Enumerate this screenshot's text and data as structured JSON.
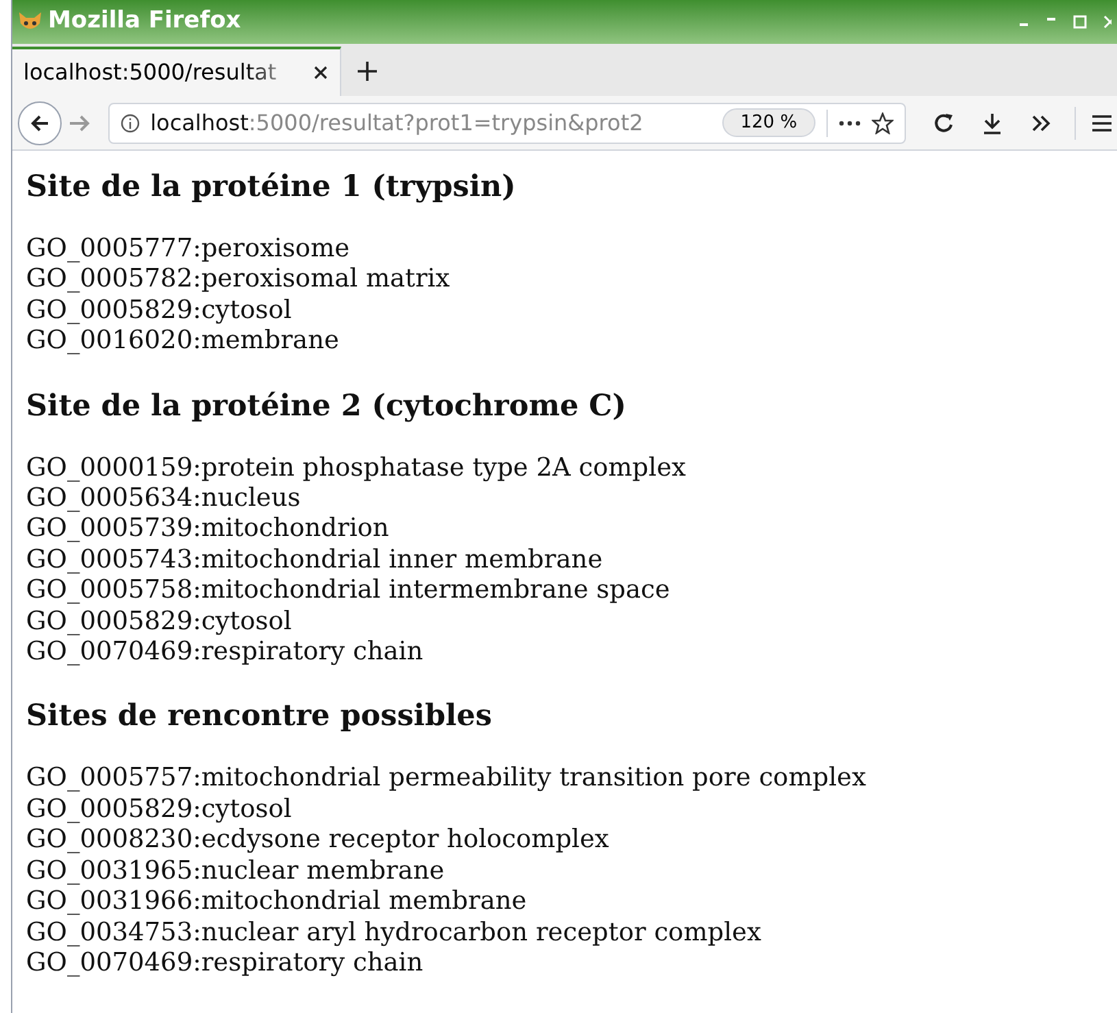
{
  "window": {
    "title": "Mozilla Firefox"
  },
  "tabs": [
    {
      "label": "localhost:5000/resultat",
      "selected": true
    }
  ],
  "address_bar": {
    "host": "localhost",
    "rest": ":5000/resultat?prot1=trypsin&prot2",
    "zoom": "120 %"
  },
  "sections": [
    {
      "heading": "Site de la protéine 1 (trypsin)",
      "items": [
        "GO_0005777:peroxisome",
        "GO_0005782:peroxisomal matrix",
        "GO_0005829:cytosol",
        "GO_0016020:membrane"
      ]
    },
    {
      "heading": "Site de la protéine 2 (cytochrome C)",
      "items": [
        "GO_0000159:protein phosphatase type 2A complex",
        "GO_0005634:nucleus",
        "GO_0005739:mitochondrion",
        "GO_0005743:mitochondrial inner membrane",
        "GO_0005758:mitochondrial intermembrane space",
        "GO_0005829:cytosol",
        "GO_0070469:respiratory chain"
      ]
    },
    {
      "heading": "Sites de rencontre possibles",
      "items": [
        "GO_0005757:mitochondrial permeability transition pore complex",
        "GO_0005829:cytosol",
        "GO_0008230:ecdysone receptor holocomplex",
        "GO_0031965:nuclear membrane",
        "GO_0031966:mitochondrial membrane",
        "GO_0034753:nuclear aryl hydrocarbon receptor complex",
        "GO_0070469:respiratory chain"
      ]
    }
  ]
}
